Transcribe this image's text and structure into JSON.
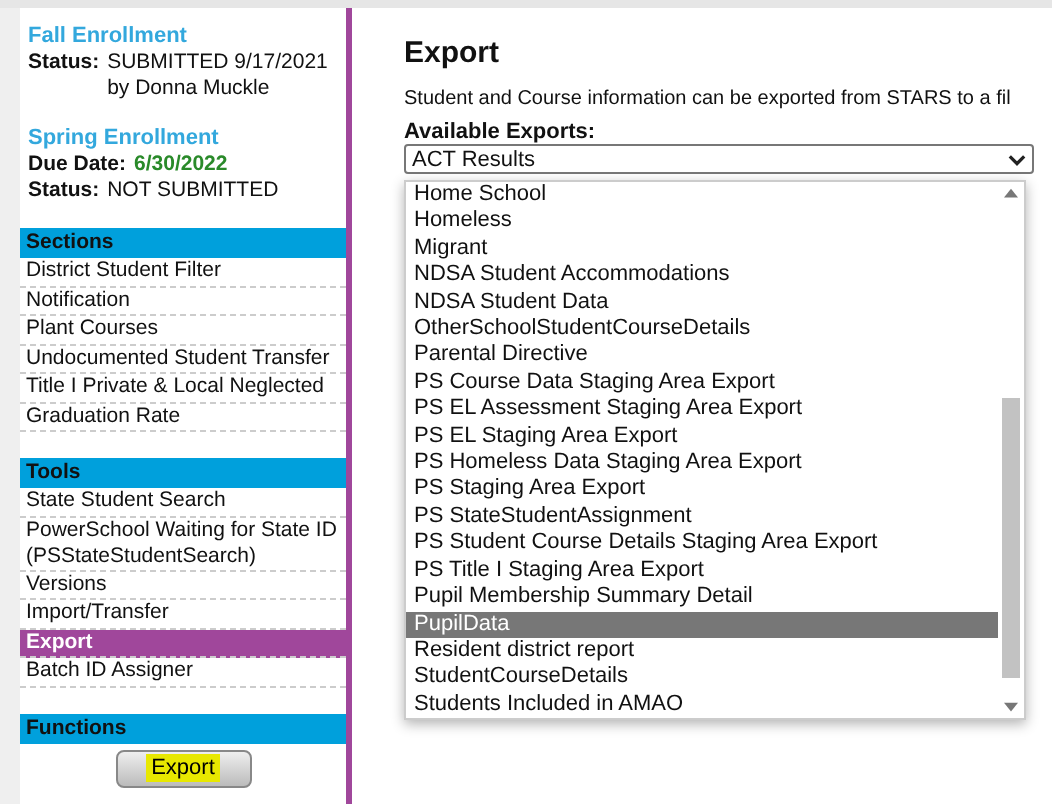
{
  "enrollment": [
    {
      "title": "Fall Enrollment",
      "fields": [
        {
          "label": "Status:",
          "value": "SUBMITTED 9/17/2021",
          "extra": "by Donna Muckle",
          "kind": "plain"
        }
      ]
    },
    {
      "title": "Spring Enrollment",
      "fields": [
        {
          "label": "Due Date:",
          "value": "6/30/2022",
          "kind": "date"
        },
        {
          "label": "Status:",
          "value": "NOT SUBMITTED",
          "kind": "plain"
        }
      ]
    }
  ],
  "sidebar": {
    "groups": [
      {
        "title": "Sections",
        "items": [
          {
            "label": "District Student Filter",
            "selected": false
          },
          {
            "label": "Notification",
            "selected": false
          },
          {
            "label": "Plant Courses",
            "selected": false
          },
          {
            "label": "Undocumented Student Transfer",
            "selected": false
          },
          {
            "label": "Title I Private & Local Neglected",
            "selected": false
          },
          {
            "label": "Graduation Rate",
            "selected": false
          }
        ]
      },
      {
        "title": "Tools",
        "items": [
          {
            "label": "State Student Search",
            "selected": false
          },
          {
            "label": "PowerSchool Waiting for State ID (PSStateStudentSearch)",
            "selected": false
          },
          {
            "label": "Versions",
            "selected": false
          },
          {
            "label": "Import/Transfer",
            "selected": false
          },
          {
            "label": "Export",
            "selected": true
          },
          {
            "label": "Batch ID Assigner",
            "selected": false
          }
        ]
      },
      {
        "title": "Functions",
        "button": "Export"
      }
    ]
  },
  "main": {
    "title": "Export",
    "description": "Student and Course information can be exported from STARS to a fil",
    "exports": {
      "label": "Available Exports:",
      "value": "ACT Results",
      "options": [
        {
          "label": "Home School",
          "selected": false
        },
        {
          "label": "Homeless",
          "selected": false
        },
        {
          "label": "Migrant",
          "selected": false
        },
        {
          "label": "NDSA Student Accommodations",
          "selected": false
        },
        {
          "label": "NDSA Student Data",
          "selected": false
        },
        {
          "label": "OtherSchoolStudentCourseDetails",
          "selected": false
        },
        {
          "label": "Parental Directive",
          "selected": false
        },
        {
          "label": "PS Course Data Staging Area Export",
          "selected": false
        },
        {
          "label": "PS EL Assessment Staging Area Export",
          "selected": false
        },
        {
          "label": "PS EL Staging Area Export",
          "selected": false
        },
        {
          "label": "PS Homeless Data Staging Area Export",
          "selected": false
        },
        {
          "label": "PS Staging Area Export",
          "selected": false
        },
        {
          "label": "PS StateStudentAssignment",
          "selected": false
        },
        {
          "label": "PS Student Course Details Staging Area Export",
          "selected": false
        },
        {
          "label": "PS Title I Staging Area Export",
          "selected": false
        },
        {
          "label": "Pupil Membership Summary Detail",
          "selected": false
        },
        {
          "label": "PupilData",
          "selected": true
        },
        {
          "label": "Resident district report",
          "selected": false
        },
        {
          "label": "StudentCourseDetails",
          "selected": false
        },
        {
          "label": "Students Included in AMAO",
          "selected": false
        }
      ]
    }
  }
}
